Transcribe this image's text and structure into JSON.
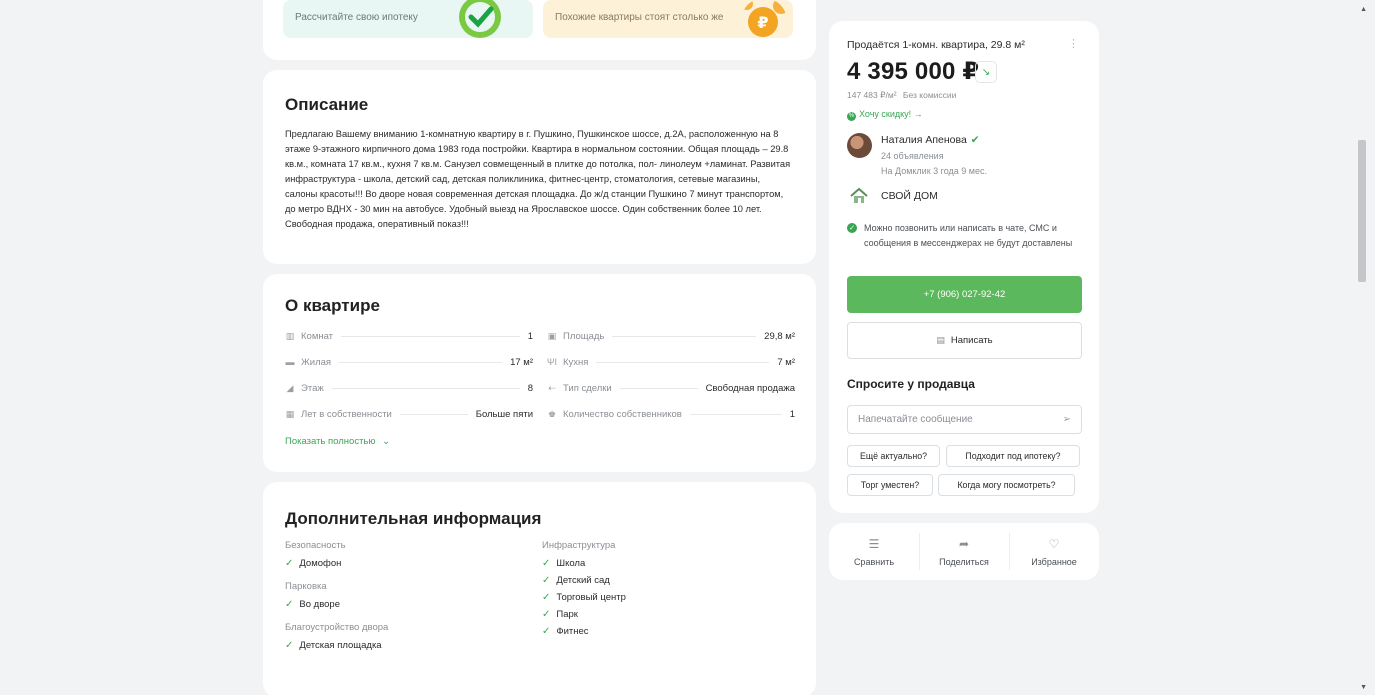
{
  "promos": {
    "mortgage": "Рассчитайте свою ипотеку",
    "prices": "Похожие квартиры стоят столько же"
  },
  "description": {
    "title": "Описание",
    "text": "Предлагаю Вашему вниманию 1-комнатную квартиру в г. Пушкино, Пушкинское шоссе, д.2А, расположенную на 8 этаже 9-этажного кирпичного дома 1983 года постройки. Квартира в нормальном состоянии. Общая площадь – 29.8 кв.м., комната 17 кв.м., кухня 7 кв.м. Санузел совмещенный в плитке до потолка, пол- линолеум +ламинат. Развитая инфраструктура - школа, детский сад, детская поликлиника, фитнес-центр, стоматология, сетевые магазины, салоны красоты!!! Во дворе новая современная детская площадка. До ж/д станции Пушкино 7 минут транспортом, до метро ВДНХ - 30 мин на автобусе. Удобный выезд на Ярославское шоссе. Один собственник более 10 лет. Свободная продажа, оперативный показ!!!"
  },
  "about": {
    "title": "О квартире",
    "params_left": [
      {
        "icon": "door-icon",
        "label": "Комнат",
        "value": "1"
      },
      {
        "icon": "sofa-icon",
        "label": "Жилая",
        "value": "17 м²"
      },
      {
        "icon": "stairs-icon",
        "label": "Этаж",
        "value": "8"
      },
      {
        "icon": "calendar-icon",
        "label": "Лет в собственности",
        "value": "Больше пяти"
      }
    ],
    "params_right": [
      {
        "icon": "area-icon",
        "label": "Площадь",
        "value": "29,8 м²"
      },
      {
        "icon": "fork-knife-icon",
        "label": "Кухня",
        "value": "7 м²"
      },
      {
        "icon": "exchange-icon",
        "label": "Тип сделки",
        "value": "Свободная продажа"
      },
      {
        "icon": "people-icon",
        "label": "Количество собственников",
        "value": "1"
      }
    ],
    "show_more": "Показать полностью"
  },
  "extra": {
    "title": "Дополнительная информация",
    "security": {
      "head": "Безопасность",
      "items": [
        "Домофон"
      ]
    },
    "parking": {
      "head": "Парковка",
      "items": [
        "Во дворе"
      ]
    },
    "yard": {
      "head": "Благоустройство двора",
      "items": [
        "Детская площадка"
      ]
    },
    "infra": {
      "head": "Инфраструктура",
      "items": [
        "Школа",
        "Детский сад",
        "Торговый центр",
        "Парк",
        "Фитнес"
      ]
    }
  },
  "listing": {
    "title": "Продаётся 1-комн. квартира, 29.8 м²",
    "price": "4 395 000 ₽",
    "price_per_m": "147 483 ₽/м²",
    "commission": "Без комиссии",
    "discount": "Хочу скидку! →"
  },
  "seller": {
    "name": "Наталия Апенова",
    "ads": "24 объявления",
    "since": "На Домклик 3 года 9 мес.",
    "agency": "СВОЙ ДОМ",
    "notice": "Можно позвонить или написать в чате, СМС и сообщения в мессенджерах не будут доставлены",
    "phone": "+7 (906) 027-92-42",
    "write": "Написать"
  },
  "ask": {
    "title": "Спросите у продавца",
    "placeholder": "Напечатайте сообщение",
    "chips": [
      "Ещё актуально?",
      "Подходит под ипотеку?",
      "Торг уместен?",
      "Когда могу посмотреть?"
    ]
  },
  "actions": {
    "compare": "Сравнить",
    "share": "Поделиться",
    "favorite": "Избранное"
  },
  "colors": {
    "accent": "#5cb85c",
    "accent_text": "#3aa655",
    "background": "#f2f3f5"
  }
}
